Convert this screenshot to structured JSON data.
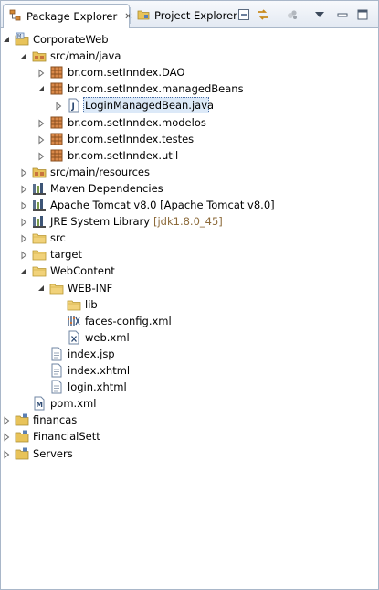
{
  "tabs": {
    "active_label": "Package Explorer",
    "inactive_label": "Project Explorer"
  },
  "toolbar": {
    "collapse_icon": "collapse-all-icon",
    "link_icon": "link-with-editor-icon",
    "focus_icon": "focus-icon",
    "menu_icon": "view-menu-icon",
    "minimize_icon": "minimize-icon",
    "maximize_icon": "maximize-icon"
  },
  "colors": {
    "border": "#a9b7c9",
    "tab_bg": "#e3e9f2",
    "selection_bg": "#dce9f8",
    "folder": "#e8c35a",
    "package": "#c8743d",
    "library_dim_text": "#8c6a3a"
  },
  "tree": {
    "items": [
      {
        "label": "CorporateWeb",
        "expanded": true,
        "icon": "web-project-icon"
      },
      {
        "label": "src/main/java",
        "expanded": true,
        "icon": "source-folder-icon"
      },
      {
        "label": "br.com.setInndex.DAO",
        "expanded": false,
        "icon": "package-icon"
      },
      {
        "label": "br.com.setInndex.managedBeans",
        "expanded": true,
        "icon": "package-icon"
      },
      {
        "label": "LoginManagedBean.java",
        "expanded": false,
        "icon": "java-file-icon",
        "selected": true
      },
      {
        "label": "br.com.setInndex.modelos",
        "expanded": false,
        "icon": "package-icon"
      },
      {
        "label": "br.com.setInndex.testes",
        "expanded": false,
        "icon": "package-icon"
      },
      {
        "label": "br.com.setInndex.util",
        "expanded": false,
        "icon": "package-icon"
      },
      {
        "label": "src/main/resources",
        "expanded": false,
        "icon": "source-folder-icon"
      },
      {
        "label": "Maven Dependencies",
        "expanded": false,
        "icon": "library-icon"
      },
      {
        "label": "Apache Tomcat v8.0 [Apache Tomcat v8.0]",
        "expanded": false,
        "icon": "library-icon"
      },
      {
        "label": "JRE System Library",
        "suffix": "[jdk1.8.0_45]",
        "expanded": false,
        "icon": "library-icon"
      },
      {
        "label": "src",
        "expanded": false,
        "icon": "folder-icon"
      },
      {
        "label": "target",
        "expanded": false,
        "icon": "folder-icon"
      },
      {
        "label": "WebContent",
        "expanded": true,
        "icon": "folder-icon"
      },
      {
        "label": "WEB-INF",
        "expanded": true,
        "icon": "folder-icon"
      },
      {
        "label": "lib",
        "icon": "folder-icon"
      },
      {
        "label": "faces-config.xml",
        "icon": "faces-config-icon"
      },
      {
        "label": "web.xml",
        "icon": "xml-file-icon"
      },
      {
        "label": "index.jsp",
        "icon": "file-icon"
      },
      {
        "label": "index.xhtml",
        "icon": "file-icon"
      },
      {
        "label": "login.xhtml",
        "icon": "file-icon"
      },
      {
        "label": "pom.xml",
        "icon": "maven-pom-icon"
      },
      {
        "label": "financas",
        "expanded": false,
        "icon": "project-icon"
      },
      {
        "label": "FinancialSett",
        "expanded": false,
        "icon": "project-icon"
      },
      {
        "label": "Servers",
        "expanded": false,
        "icon": "project-icon"
      }
    ]
  }
}
